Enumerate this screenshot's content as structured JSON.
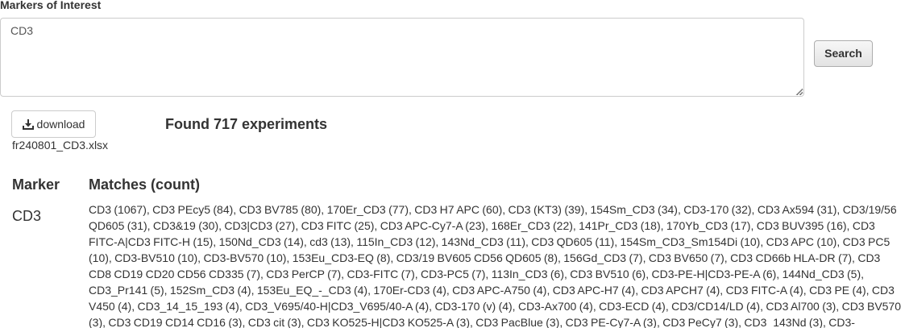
{
  "form": {
    "label": "Markers of Interest",
    "textarea_value": "CD3",
    "search_label": "Search"
  },
  "download": {
    "button_label": "download",
    "file_name": "fr240801_CD3.xlsx"
  },
  "results": {
    "summary": "Found 717 experiments",
    "table": {
      "headers": {
        "marker": "Marker",
        "matches": "Matches (count)"
      },
      "rows": [
        {
          "marker": "CD3",
          "matches": "CD3 (1067), CD3 PEcy5 (84), CD3 BV785 (80), 170Er_CD3 (77), CD3 H7 APC (60), CD3 (KT3) (39), 154Sm_CD3 (34), CD3-170 (32), CD3 Ax594 (31), CD3/19/56 QD605 (31), CD3&19 (30), CD3|CD3 (27), CD3 FITC (25), CD3 APC-Cy7-A (23), 168Er_CD3 (22), 141Pr_CD3 (18), 170Yb_CD3 (17), CD3 BUV395 (16), CD3 FITC-A|CD3 FITC-H (15), 150Nd_CD3 (14), cd3 (13), 115In_CD3 (12), 143Nd_CD3 (11), CD3 QD605 (11), 154Sm_CD3_Sm154Di (10), CD3 APC (10), CD3 PC5 (10), CD3-BV510 (10), CD3-BV570 (10), 153Eu_CD3-EQ (8), CD3/19 BV605 CD56 QD605 (8), 156Gd_CD3 (7), CD3 BV650 (7), CD3 CD66b HLA-DR (7), CD3 CD8 CD19 CD20 CD56 CD335 (7), CD3 PerCP (7), CD3-FITC (7), CD3-PC5 (7), 113In_CD3 (6), CD3 BV510 (6), CD3-PE-H|CD3-PE-A (6), 144Nd_CD3 (5), CD3_Pr141 (5), 152Sm_CD3 (4), 153Eu_EQ_-_CD3 (4), 170Er-CD3 (4), CD3 APC-A750 (4), CD3 APC-H7 (4), CD3 APCH7 (4), CD3 FITC-A (4), CD3 PE (4), CD3 V450 (4), CD3_14_15_193 (4), CD3_V695/40-H|CD3_V695/40-A (4), CD3-170 (v) (4), CD3-Ax700 (4), CD3-ECD (4), CD3/CD14/LD (4), CD3 Al700 (3), CD3 BV570 (3), CD3 CD19 CD14 CD16 (3), CD3 cit (3), CD3 KO525-H|CD3 KO525-A (3), CD3 PacBlue (3), CD3 PE-Cy7-A (3), CD3 PeCy7 (3), CD3_143Nd (3), CD3-"
        }
      ]
    }
  }
}
